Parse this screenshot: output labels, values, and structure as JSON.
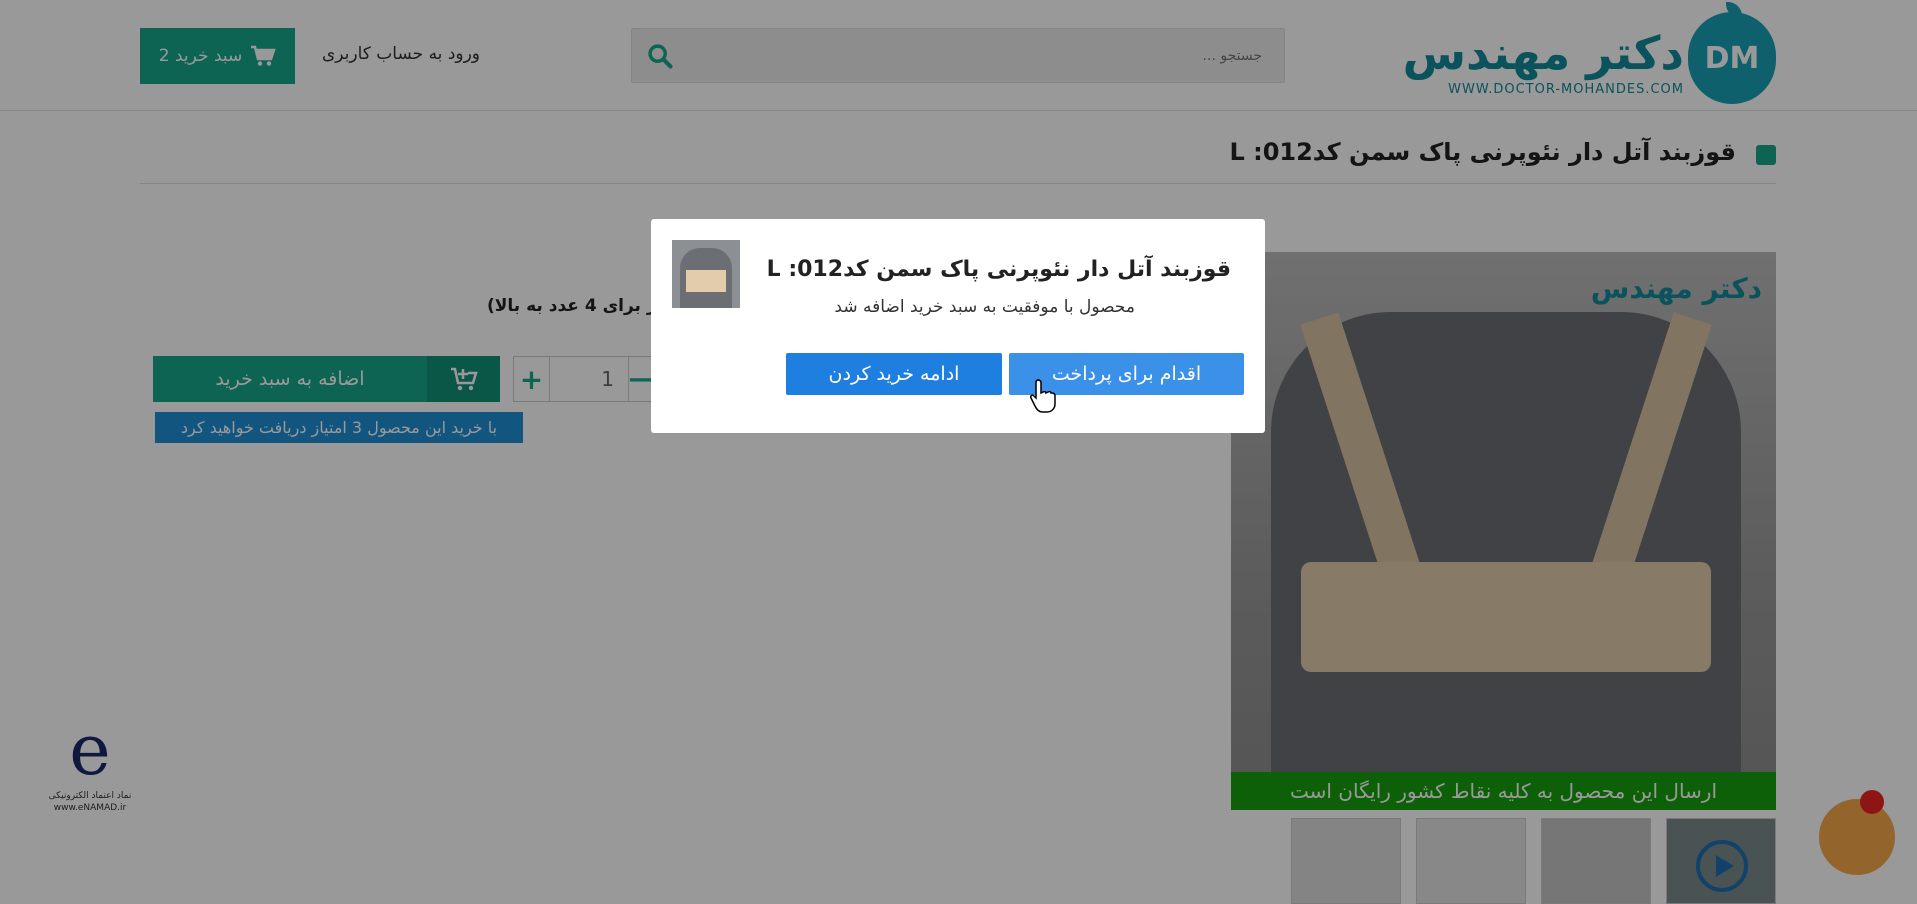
{
  "header": {
    "logo_text": "دکتر مهندس",
    "logo_url_text": "WWW.DOCTOR-MOHANDES.COM",
    "logo_badge": "DM",
    "search": {
      "placeholder": "جستجو ..."
    },
    "login_label": "ورود به حساب کاربری",
    "cart_label": "سبد خرید 2"
  },
  "product": {
    "title": "قوزبند آتل دار نئوپرنی پاک سمن کد012: L",
    "discount_note": "ار برای 4 عدد به بالا)",
    "quantity": "1",
    "qty_plus": "+",
    "qty_minus": "—",
    "add_to_cart_label": "اضافه به سبد خرید",
    "points_note": "با خرید این محصول 3 امتیاز دریافت خواهید کرد",
    "image_logo_text": "دکتر مهندس",
    "free_shipping": "ارسال این محصول به کلیه نقاط کشور رایگان است"
  },
  "enamad": {
    "mark": "e",
    "text": "نماد اعتماد الکترونیکی www.eNAMAD.ir"
  },
  "modal": {
    "title": "قوزبند آتل دار نئوپرنی پاک سمن کد012: L",
    "message": "محصول با موفقیت به سبد خرید اضافه شد",
    "checkout_label": "اقدام برای پرداخت",
    "continue_label": "ادامه خرید کردن"
  },
  "colors": {
    "accent": "#17a78b",
    "primary_button": "#3b91e8",
    "free_ship_bar": "#16a00e",
    "points_bar": "#1e8fd6"
  }
}
